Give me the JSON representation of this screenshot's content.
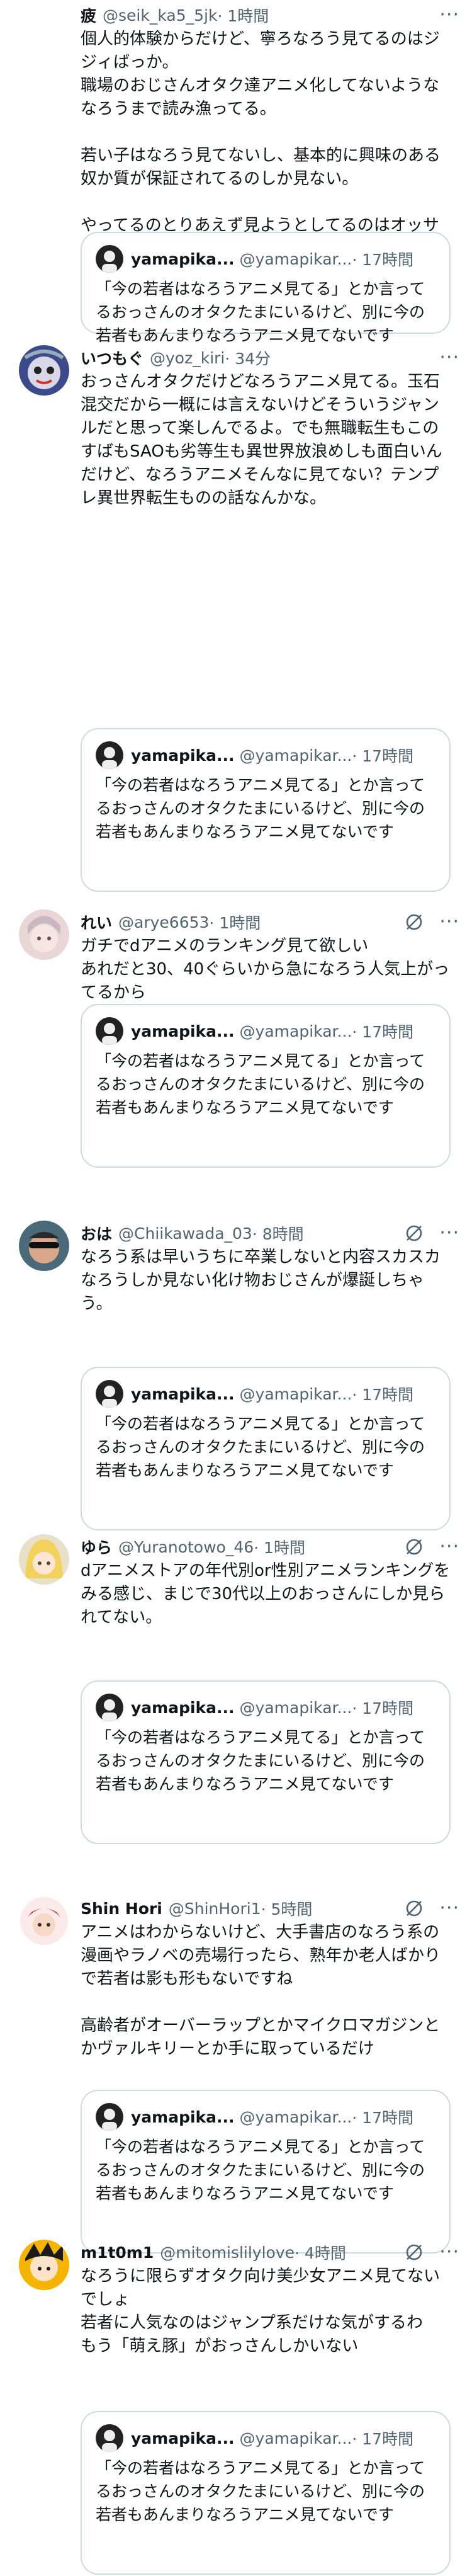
{
  "quoted": {
    "name": "yamapika...",
    "handle": "@yamapikar...",
    "time": " · 17時間",
    "text": "「今の若者はなろうアニメ見てる」とか言ってるおっさんのオタクたまにいるけど、別に今の若者もあんまりなろうアニメ見てないです"
  },
  "posts": [
    {
      "name": "疲",
      "handle": "@seik_ka5_5jk",
      "time": " · 1時間",
      "text": "個人的体験からだけど、寧ろなろう見てるのはジジィばっか。\n職場のおじさんオタク達アニメ化してないようななろうまで読み漁ってる。\n\n若い子はなろう見てないし、基本的に興味のある奴か質が保証されてるのしか見ない。\n\nやってるのとりあえず見ようとしてるのはオッサンばかりや。"
    },
    {
      "name": "いつもぐ",
      "handle": "@yoz_kiri",
      "time": " · 34分",
      "text": "おっさんオタクだけどなろうアニメ見てる。玉石混交だから一概には言えないけどそういうジャンルだと思って楽しんでるよ。でも無職転生もこのすばもSAOも劣等生も異世界放浪めしも面白いんだけど、なろうアニメそんなに見てない？テンプレ異世界転生ものの話なんかな。"
    },
    {
      "name": "れい",
      "handle": "@arye6653",
      "time": " · 1時間",
      "text": "ガチでdアニメのランキング見て欲しい\nあれだと30、40ぐらいから急になろう人気上がってるから"
    },
    {
      "name": "おは",
      "handle": "@Chiikawada_03",
      "time": " · 8時間",
      "text": "なろう系は早いうちに卒業しないと内容スカスカなろうしか見ない化け物おじさんが爆誕しちゃう。"
    },
    {
      "name": "ゆら",
      "handle": "@Yuranotowo_46",
      "time": " · 1時間",
      "text": "dアニメストアの年代別or性別アニメランキングをみる感じ、まじで30代以上のおっさんにしか見られてない。"
    },
    {
      "name": "Shin Hori",
      "handle": "@ShinHori1",
      "time": " · 5時間",
      "text": "アニメはわからないけど、大手書店のなろう系の漫画やラノベの売場行ったら、熟年か老人ばかりで若者は影も形もないですね\n\n高齢者がオーバーラップとかマイクロマガジンとかヴァルキリーとか手に取っているだけ"
    },
    {
      "name": "m1t0m1",
      "handle": "@mitomislilylove",
      "time": " · 4時間",
      "text": "なろうに限らずオタク向け美少女アニメ見てないでしょ\n若者に人気なのはジャンプ系だけな気がするわ\nもう「萌え豚」がおっさんしかいない"
    }
  ]
}
